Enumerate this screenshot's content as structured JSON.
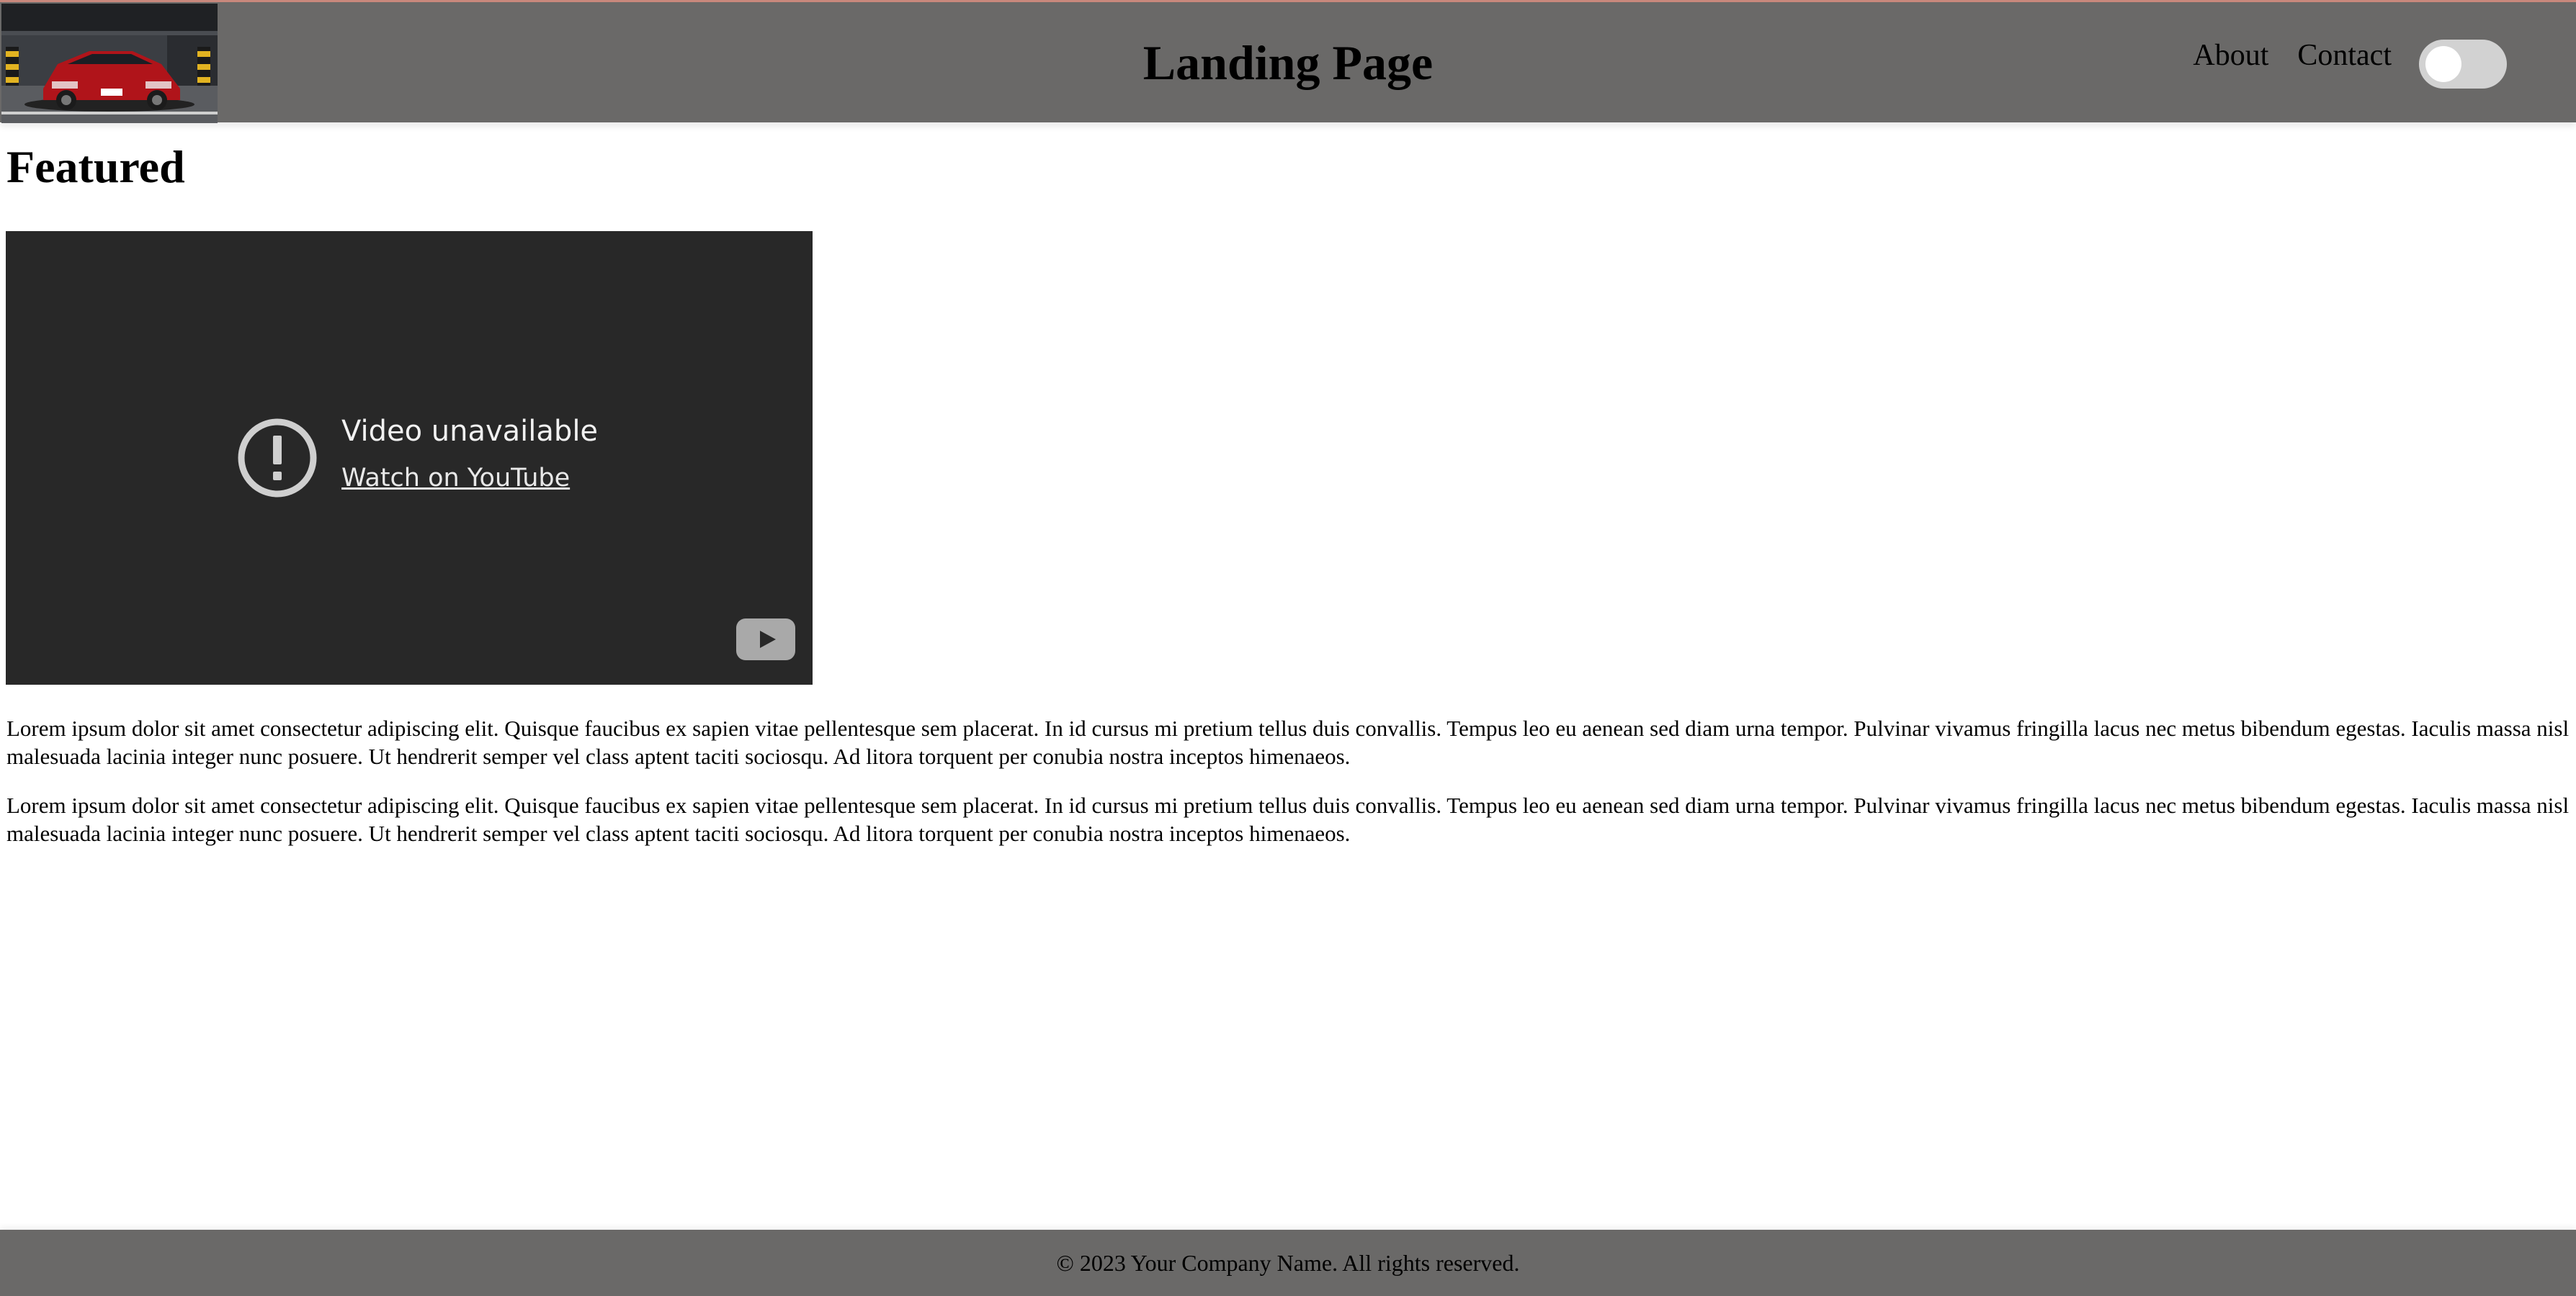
{
  "header": {
    "title": "Landing Page",
    "logo_icon": "car-photo",
    "nav": [
      {
        "label": "About"
      },
      {
        "label": "Contact"
      }
    ],
    "theme_toggle": {
      "on": false
    }
  },
  "main": {
    "heading": "Featured",
    "video": {
      "message": "Video unavailable",
      "link_text": "Watch on YouTube",
      "icon": "alert-circle-icon",
      "brand_icon": "youtube-icon"
    },
    "paragraphs": [
      "Lorem ipsum dolor sit amet consectetur adipiscing elit. Quisque faucibus ex sapien vitae pellentesque sem placerat. In id cursus mi pretium tellus duis convallis. Tempus leo eu aenean sed diam urna tempor. Pulvinar vivamus fringilla lacus nec metus bibendum egestas. Iaculis massa nisl malesuada lacinia integer nunc posuere. Ut hendrerit semper vel class aptent taciti sociosqu. Ad litora torquent per conubia nostra inceptos himenaeos.",
      "Lorem ipsum dolor sit amet consectetur adipiscing elit. Quisque faucibus ex sapien vitae pellentesque sem placerat. In id cursus mi pretium tellus duis convallis. Tempus leo eu aenean sed diam urna tempor. Pulvinar vivamus fringilla lacus nec metus bibendum egestas. Iaculis massa nisl malesuada lacinia integer nunc posuere. Ut hendrerit semper vel class aptent taciti sociosqu. Ad litora torquent per conubia nostra inceptos himenaeos."
    ]
  },
  "footer": {
    "text": "© 2023 Your Company Name. All rights reserved."
  },
  "colors": {
    "header_bg": "#6a6968",
    "footer_bg": "#6a6968",
    "video_bg": "#282828",
    "toggle_bg": "#d2d2d2"
  }
}
